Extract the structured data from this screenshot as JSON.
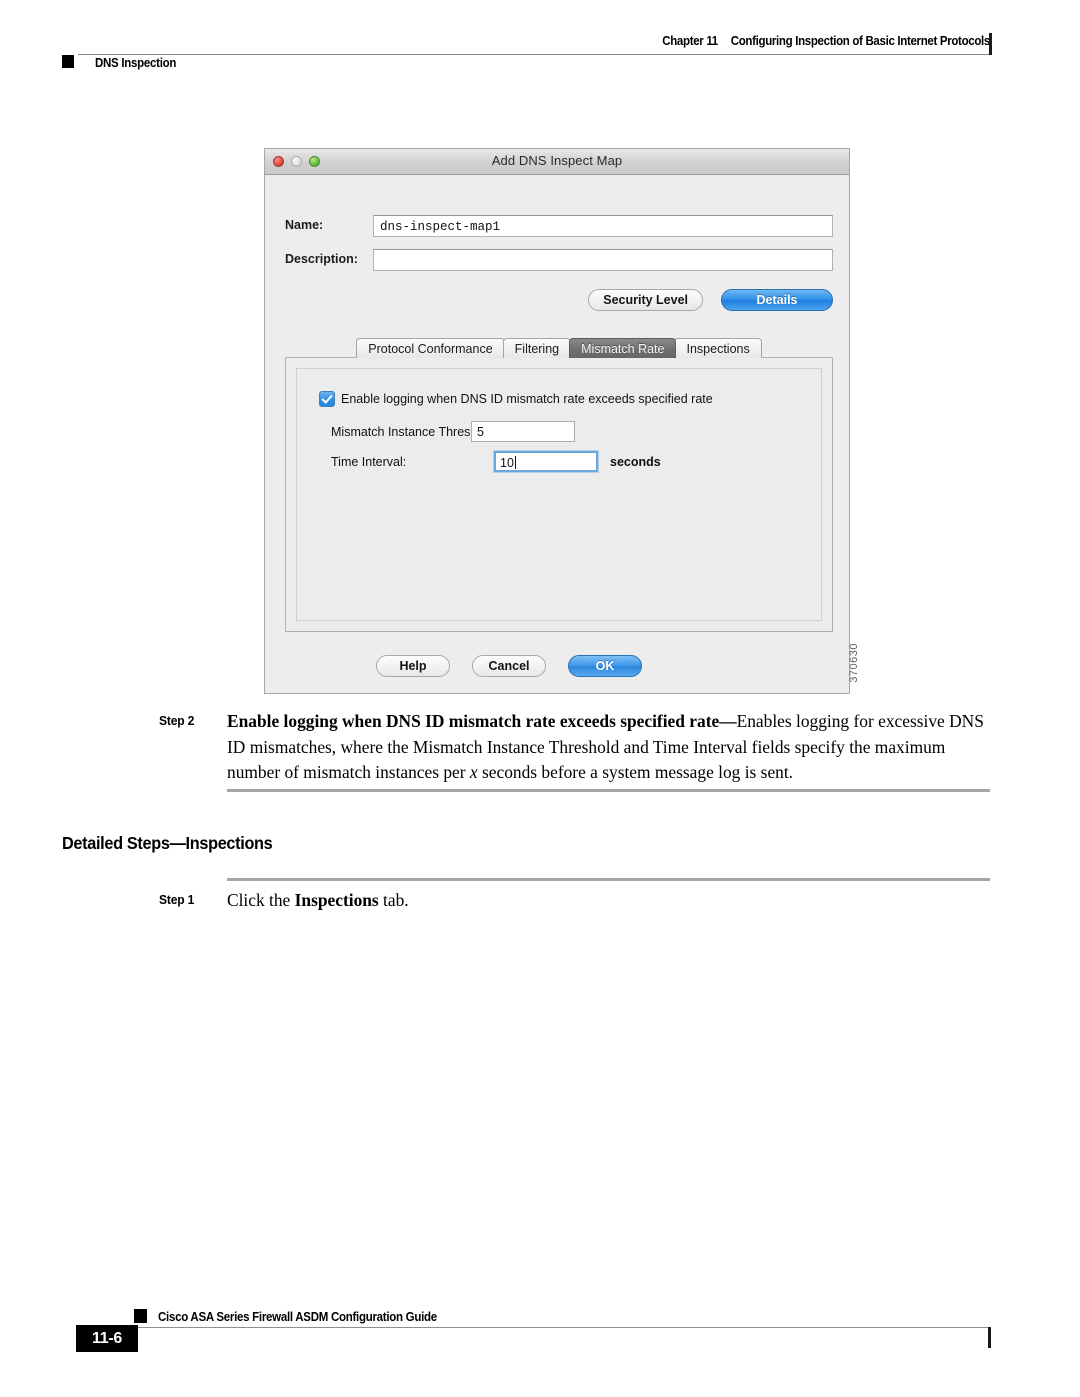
{
  "page_header": {
    "chapter_label": "Chapter 11",
    "chapter_title": "Configuring Inspection of Basic Internet Protocols",
    "section_label": "DNS Inspection"
  },
  "figure": {
    "figure_number": "370630",
    "dialog": {
      "title": "Add DNS Inspect Map",
      "window_controls": {
        "close": "close-button",
        "minimize": "minimize-button",
        "maximize": "maximize-button"
      },
      "fields": {
        "name_label": "Name:",
        "name_value": "dns-inspect-map1",
        "description_label": "Description:",
        "description_value": ""
      },
      "view_buttons": [
        {
          "label": "Security Level",
          "selected": false
        },
        {
          "label": "Details",
          "selected": true
        }
      ],
      "tabs": [
        {
          "label": "Protocol Conformance",
          "selected": false
        },
        {
          "label": "Filtering",
          "selected": false
        },
        {
          "label": "Mismatch Rate",
          "selected": true
        },
        {
          "label": "Inspections",
          "selected": false
        }
      ],
      "mismatch_rate_panel": {
        "enable_logging_label": "Enable logging when DNS ID mismatch rate exceeds specified rate",
        "enable_logging_checked": true,
        "threshold_label": "Mismatch Instance Threshold:",
        "threshold_value": "5",
        "interval_label": "Time Interval:",
        "interval_value": "10",
        "interval_unit": "seconds"
      },
      "action_buttons": [
        {
          "label": "Help",
          "default": false
        },
        {
          "label": "Cancel",
          "default": false
        },
        {
          "label": "OK",
          "default": true
        }
      ]
    }
  },
  "body": {
    "step2": {
      "tag": "Step 2",
      "bold_lead": "Enable logging when DNS ID mismatch rate exceeds specified rate",
      "dash": "—",
      "rest_a": "Enables logging for excessive DNS ID mismatches, where the Mismatch Instance Threshold and Time Interval fields specify the maximum number of mismatch instances per ",
      "italic_x": "x",
      "rest_b": " seconds before a system message log is sent."
    },
    "heading_detailed": "Detailed Steps—Inspections",
    "step1": {
      "tag": "Step 1",
      "lead": "Click the ",
      "bold_word": "Inspections",
      "trail": " tab."
    }
  },
  "page_footer": {
    "guide_title": "Cisco ASA Series Firewall ASDM Configuration Guide",
    "page_number": "11-6"
  },
  "colors": {
    "accent_blue": "#2f8fe8",
    "tab_selected_gray": "#6f6f6f",
    "rule_gray": "#a5a5a5",
    "dialog_bg": "#ededed"
  }
}
